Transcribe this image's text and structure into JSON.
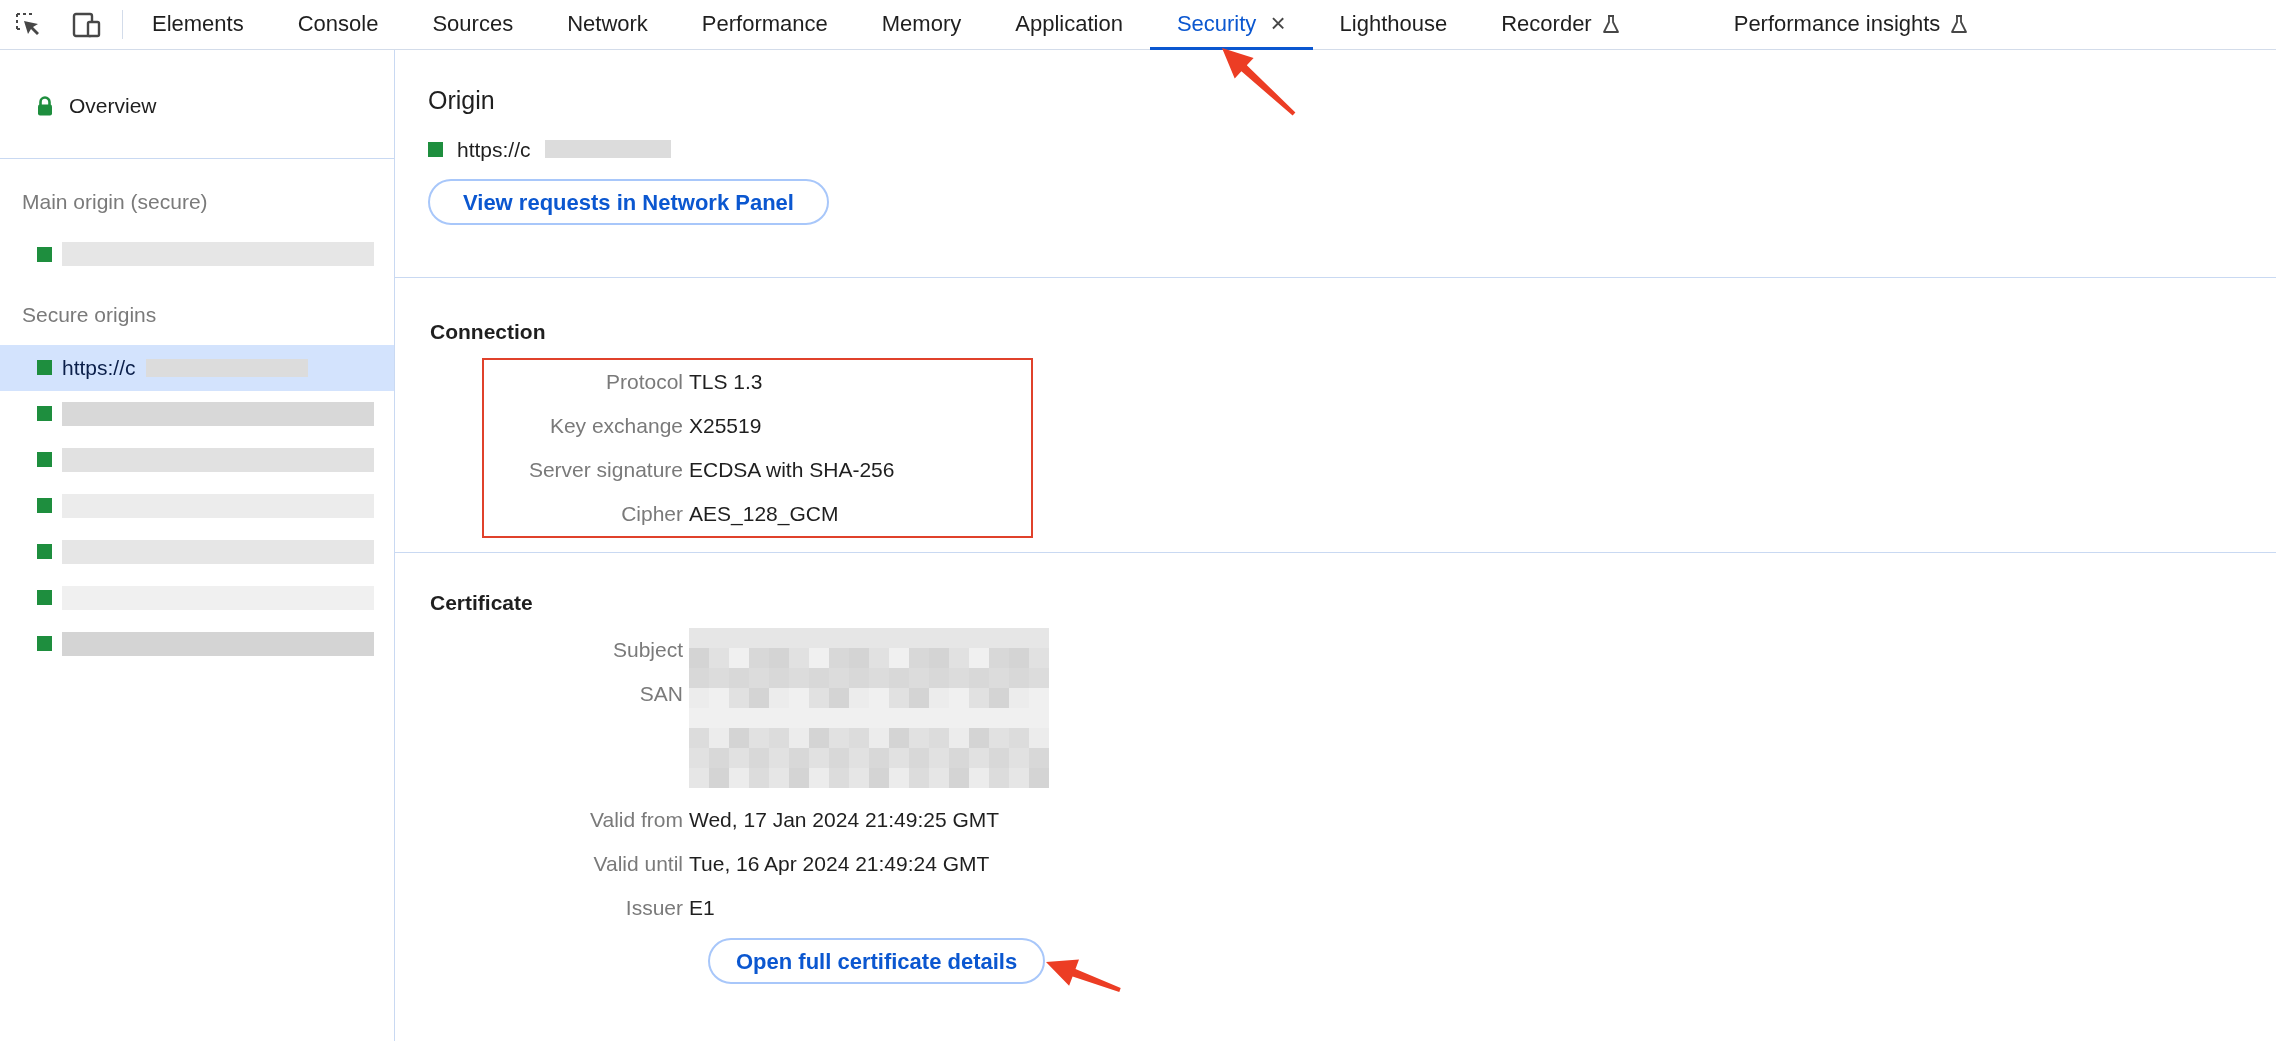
{
  "toolbar": {
    "tabs": [
      {
        "label": "Elements",
        "selected": false
      },
      {
        "label": "Console",
        "selected": false
      },
      {
        "label": "Sources",
        "selected": false
      },
      {
        "label": "Network",
        "selected": false
      },
      {
        "label": "Performance",
        "selected": false
      },
      {
        "label": "Memory",
        "selected": false
      },
      {
        "label": "Application",
        "selected": false
      },
      {
        "label": "Security",
        "selected": true,
        "closable": true
      },
      {
        "label": "Lighthouse",
        "selected": false
      },
      {
        "label": "Recorder",
        "selected": false,
        "experimental": true
      },
      {
        "label": "Performance insights",
        "selected": false,
        "experimental": true
      }
    ],
    "close_glyph": "×"
  },
  "sidebar": {
    "overview": {
      "label": "Overview"
    },
    "sections": [
      {
        "title": "Main origin (secure)",
        "items": [
          {
            "selected": false
          }
        ]
      },
      {
        "title": "Secure origins",
        "items": [
          {
            "label": "https://c",
            "selected": true
          },
          {
            "selected": false
          },
          {
            "selected": false
          },
          {
            "selected": false
          },
          {
            "selected": false
          },
          {
            "selected": false
          },
          {
            "selected": false
          }
        ]
      }
    ]
  },
  "origin": {
    "title": "Origin",
    "url": "https://c",
    "button": "View requests in Network Panel"
  },
  "connection": {
    "title": "Connection",
    "highlighted": true,
    "rows": [
      {
        "label": "Protocol",
        "value": "TLS 1.3"
      },
      {
        "label": "Key exchange",
        "value": "X25519"
      },
      {
        "label": "Server signature",
        "value": "ECDSA with SHA-256"
      },
      {
        "label": "Cipher",
        "value": "AES_128_GCM"
      }
    ]
  },
  "certificate": {
    "title": "Certificate",
    "rows": [
      {
        "label": "Subject",
        "kind": "blurred"
      },
      {
        "label": "SAN",
        "kind": "blurred"
      },
      {
        "label": "Valid from",
        "kind": "text",
        "value": "Wed, 17 Jan 2024 21:49:25 GMT"
      },
      {
        "label": "Valid until",
        "kind": "text",
        "value": "Tue, 16 Apr 2024 21:49:24 GMT"
      },
      {
        "label": "Issuer",
        "kind": "text",
        "value": "E1"
      }
    ],
    "button": "Open full certificate details"
  },
  "annotations": [
    {
      "kind": "arrow"
    },
    {
      "kind": "arrow"
    }
  ]
}
